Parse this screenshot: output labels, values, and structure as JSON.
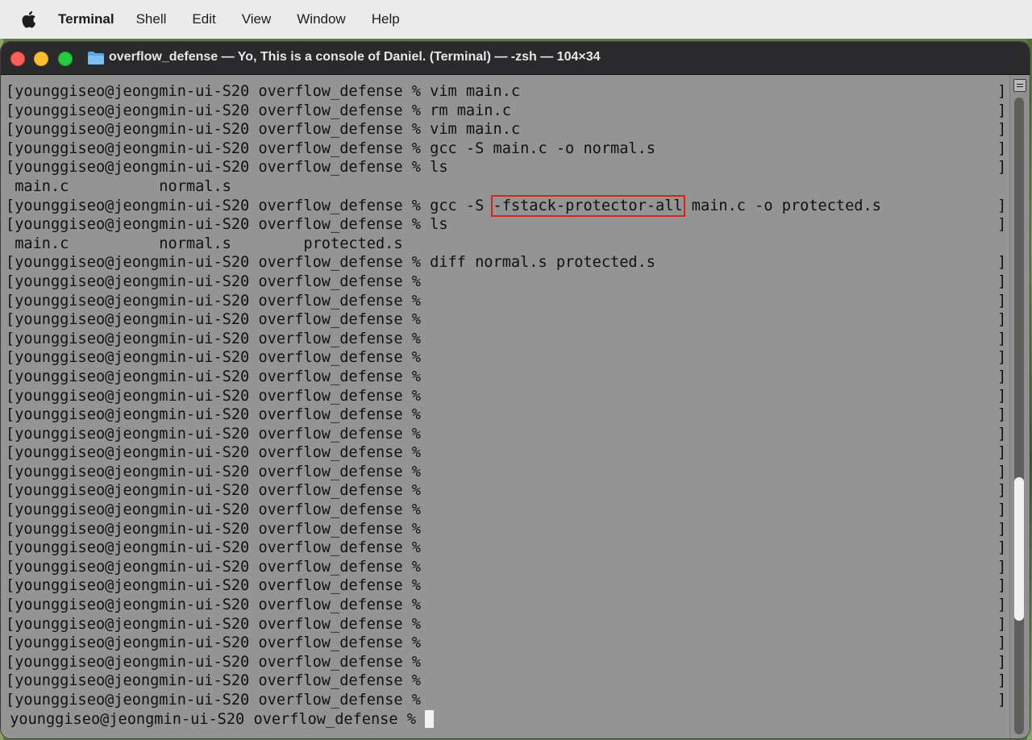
{
  "menubar": {
    "apple_icon": "apple-logo",
    "app_name": "Terminal",
    "items": [
      "Shell",
      "Edit",
      "View",
      "Window",
      "Help"
    ]
  },
  "window": {
    "title": "overflow_defense — Yo, This is a console of Daniel. (Terminal) — -zsh — 104×34",
    "folder_icon": "folder-icon",
    "traffic_lights": {
      "close": "#fe5f57",
      "minimize": "#febc2e",
      "zoom": "#28c840"
    }
  },
  "terminal": {
    "background": "#949494",
    "highlight_color": "#d6241c",
    "prompt": "[younggiseo@jeongmin-ui-S20 overflow_defense % ",
    "lines": [
      {
        "type": "cmd",
        "text": "vim main.c"
      },
      {
        "type": "cmd",
        "text": "rm main.c"
      },
      {
        "type": "cmd",
        "text": "vim main.c"
      },
      {
        "type": "cmd",
        "text": "gcc -S main.c -o normal.s"
      },
      {
        "type": "cmd",
        "text": "ls"
      },
      {
        "type": "out",
        "text": " main.c          normal.s"
      },
      {
        "type": "cmd",
        "pre": "gcc -S ",
        "hl": "-fstack-protector-all",
        "post": " main.c -o protected.s"
      },
      {
        "type": "cmd",
        "text": "ls"
      },
      {
        "type": "out",
        "text": " main.c          normal.s        protected.s"
      },
      {
        "type": "cmd",
        "text": "diff normal.s protected.s"
      },
      {
        "type": "cmd",
        "text": ""
      },
      {
        "type": "cmd",
        "text": ""
      },
      {
        "type": "cmd",
        "text": ""
      },
      {
        "type": "cmd",
        "text": ""
      },
      {
        "type": "cmd",
        "text": ""
      },
      {
        "type": "cmd",
        "text": ""
      },
      {
        "type": "cmd",
        "text": ""
      },
      {
        "type": "cmd",
        "text": ""
      },
      {
        "type": "cmd",
        "text": ""
      },
      {
        "type": "cmd",
        "text": ""
      },
      {
        "type": "cmd",
        "text": ""
      },
      {
        "type": "cmd",
        "text": ""
      },
      {
        "type": "cmd",
        "text": ""
      },
      {
        "type": "cmd",
        "text": ""
      },
      {
        "type": "cmd",
        "text": ""
      },
      {
        "type": "cmd",
        "text": ""
      },
      {
        "type": "cmd",
        "text": ""
      },
      {
        "type": "cmd",
        "text": ""
      },
      {
        "type": "cmd",
        "text": ""
      },
      {
        "type": "cmd",
        "text": ""
      },
      {
        "type": "cmd",
        "text": ""
      },
      {
        "type": "cmd",
        "text": ""
      },
      {
        "type": "cmd",
        "text": ""
      }
    ],
    "current_prompt": " younggiseo@jeongmin-ui-S20 overflow_defense % "
  },
  "scrollbar": {
    "icon": "split-pane-icon",
    "position": 0.77
  }
}
